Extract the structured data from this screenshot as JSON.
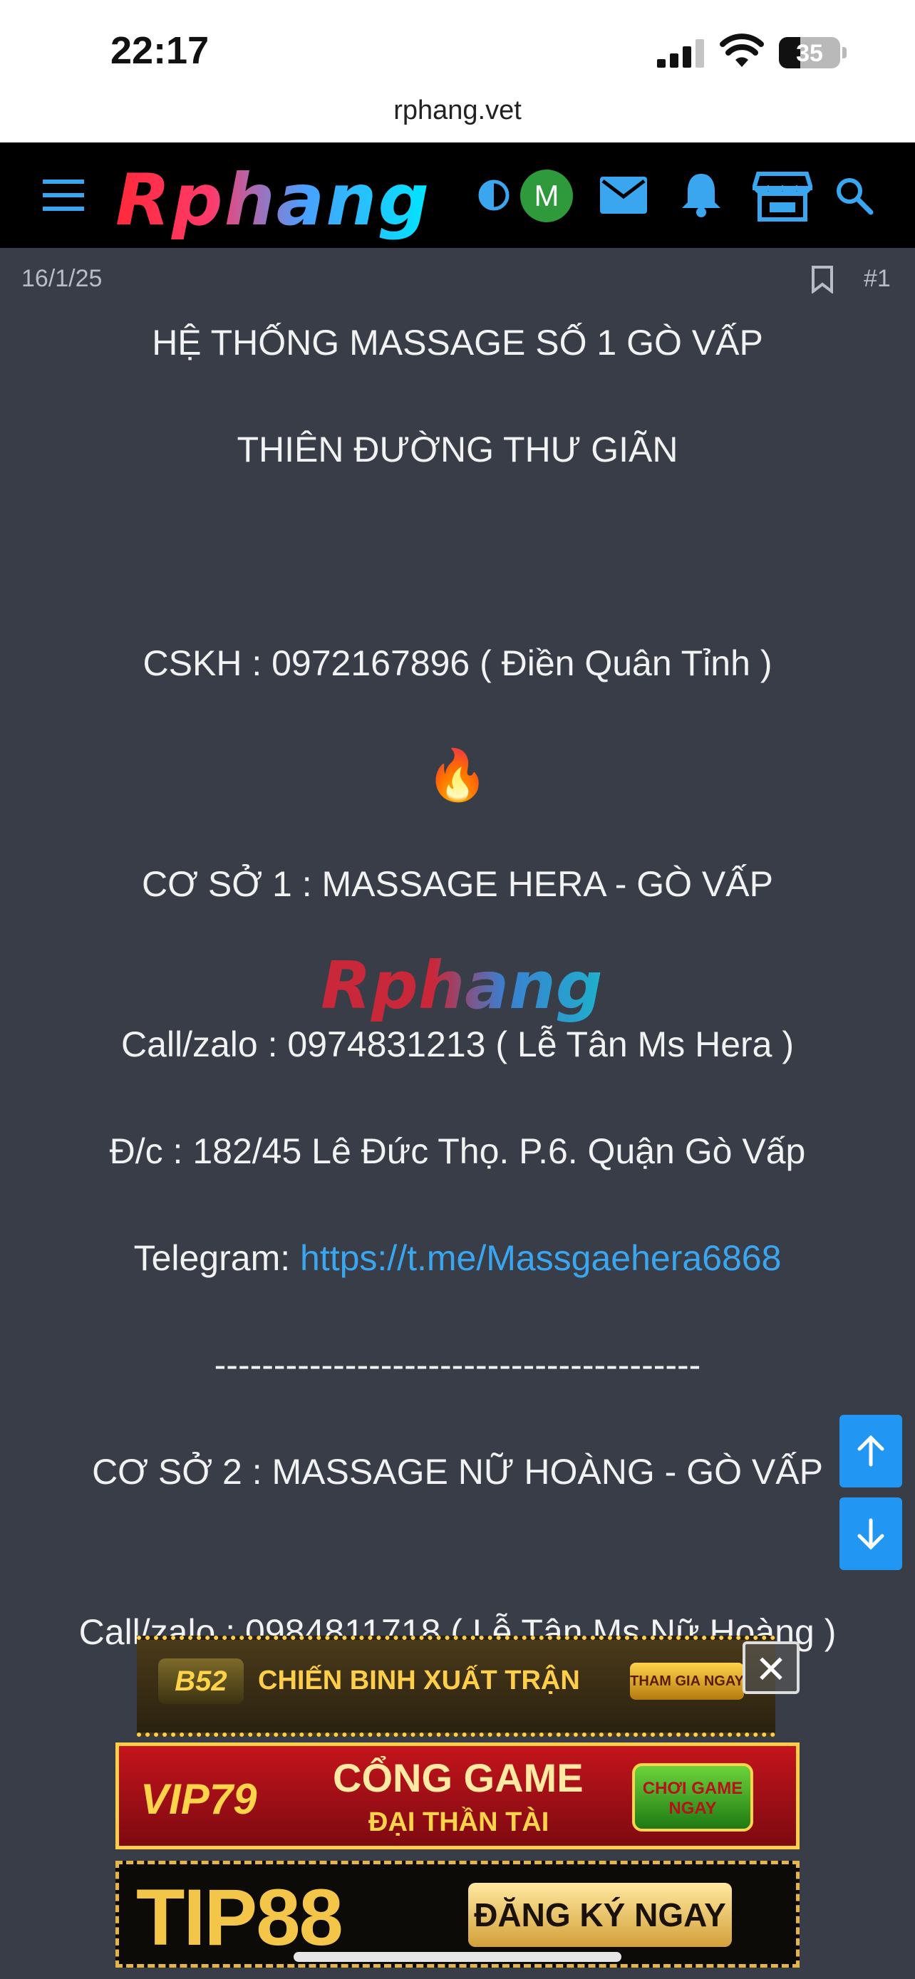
{
  "status_bar": {
    "time": "22:17",
    "battery": "35",
    "battery_level": 0.35
  },
  "browser": {
    "url": "rphang.vet"
  },
  "nav": {
    "logo_text": "Rphang",
    "avatar_letter": "M",
    "icons": [
      "menu-icon",
      "theme-toggle-icon",
      "mail-icon",
      "bell-icon",
      "store-icon",
      "search-icon"
    ],
    "accent": "#3aa6f0"
  },
  "post": {
    "date": "16/1/25",
    "number": "#1",
    "title": "HỆ THỐNG MASSAGE SỐ 1 GÒ VẤP",
    "subtitle": "THIÊN ĐƯỜNG THƯ GIÃN",
    "cskh": "CSKH : 0972167896 ( Điền Quân Tỉnh )",
    "fire": "🔥",
    "branch1": {
      "name": "CƠ SỞ 1 : MASSAGE HERA - GÒ VẤP",
      "watermark": "Rphang",
      "call": "Call/zalo : 0974831213 ( Lễ Tân Ms Hera )",
      "address": "Đ/c : 182/45 Lê Đức Thọ. P.6. Quận Gò Vấp",
      "telegram_label": "Telegram: ",
      "telegram_link": "https://t.me/Massgaehera6868"
    },
    "divider": "-----------------------------------------",
    "branch2": {
      "name": "CƠ SỞ 2 : MASSAGE NỮ HOÀNG - GÒ VẤP",
      "call": "Call/zalo : 0984811718 ( Lễ Tân Ms Nữ Hoàng )"
    }
  },
  "ads": {
    "ad1": {
      "brand": "B52",
      "headline": "CHIẾN BINH XUẤT TRẬN",
      "cta": "THAM GIA NGAY"
    },
    "ad2": {
      "brand": "VIP79",
      "headline": "CỔNG GAME",
      "sub": "ĐẠI THẦN TÀI",
      "cta": "CHƠI GAME NGAY"
    },
    "ad3": {
      "brand": "TIP88",
      "cta": "ĐĂNG KÝ NGAY"
    },
    "close": "✕"
  }
}
